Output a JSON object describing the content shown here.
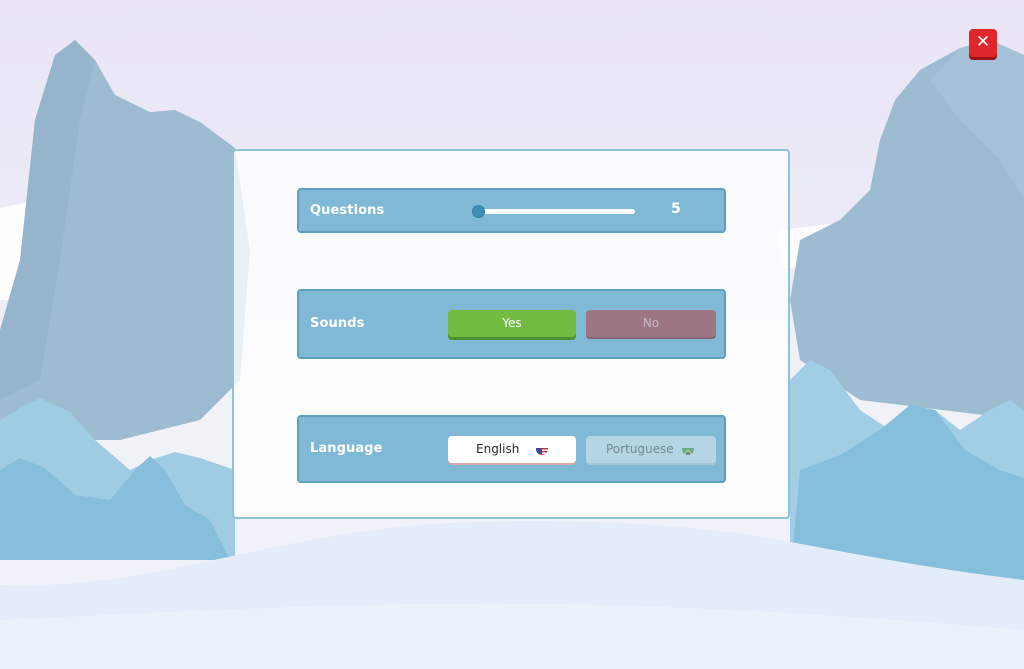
{
  "window": {
    "close_icon_glyph": "✕"
  },
  "settings": {
    "questions": {
      "label": "Questions",
      "value": "5",
      "slider_fraction": 0.0
    },
    "sounds": {
      "label": "Sounds",
      "options": [
        {
          "label": "Yes",
          "selected": true
        },
        {
          "label": "No",
          "selected": false
        }
      ]
    },
    "language": {
      "label": "Language",
      "options": [
        {
          "label": "English",
          "icon": "us-flag-icon",
          "selected": true
        },
        {
          "label": "Portuguese",
          "icon": "brazil-flag-icon",
          "selected": false
        }
      ]
    }
  },
  "colors": {
    "row_background": "#80b9d6",
    "yes_green": "#72bd41",
    "no_mauve": "#9c7682",
    "close_red": "#e0262b",
    "slider_thumb": "#3f8fb5"
  }
}
